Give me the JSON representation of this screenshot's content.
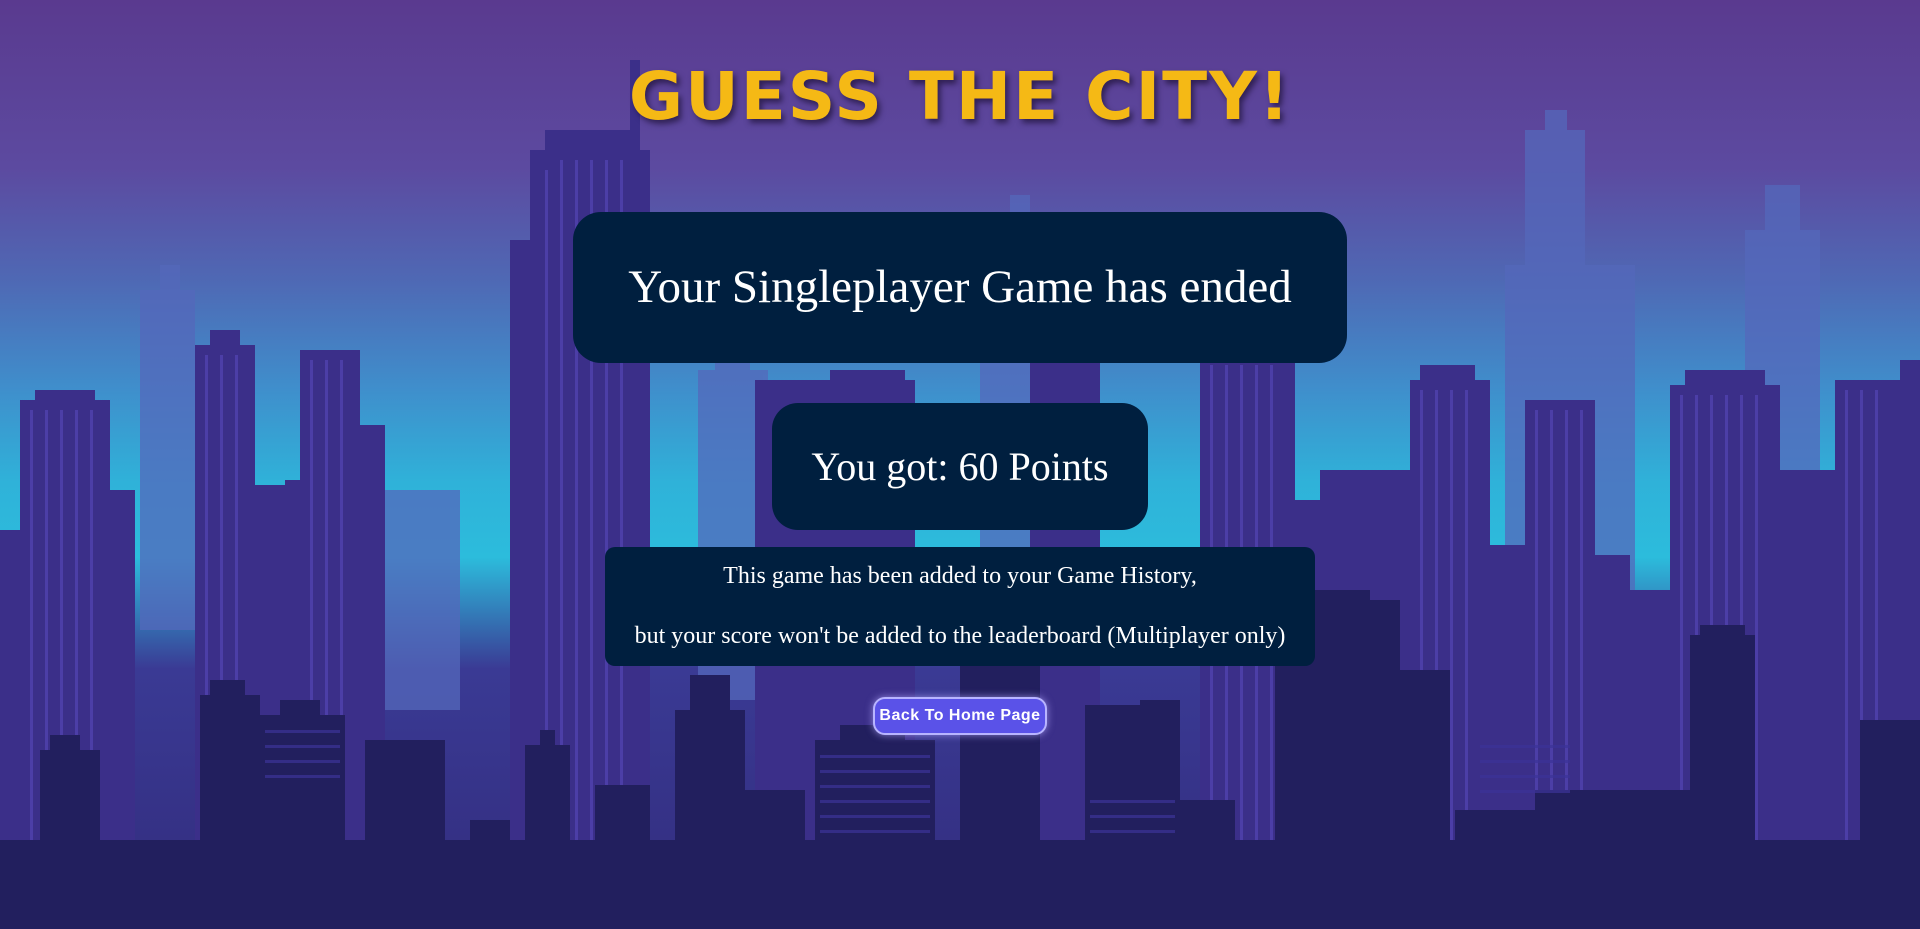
{
  "header": {
    "title": "GUESS THE CITY!"
  },
  "result": {
    "ended_message": "Your Singleplayer Game has ended",
    "score_text": "You got: 60 Points",
    "info_line_1": "This game has been added to your Game History,",
    "info_line_2": "but your score won't be added to the leaderboard (Multiplayer only)"
  },
  "actions": {
    "home_button_label": "Back To Home Page"
  },
  "colors": {
    "title": "#f5b915",
    "panel_background": "#001f3f",
    "button_background": "#5a52e8",
    "skyline_far": "#4f5fb5",
    "skyline_mid": "#3a2f86",
    "skyline_near": "#221f5e"
  }
}
